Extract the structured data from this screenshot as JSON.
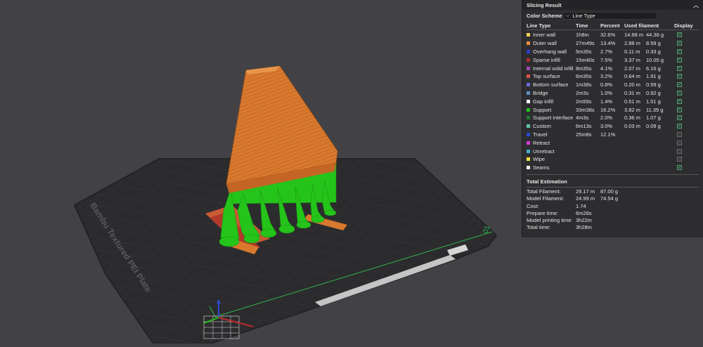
{
  "panel": {
    "title": "Slicing Result",
    "collapse_icon": "chevron-up-icon",
    "color_scheme_label": "Color Scheme",
    "color_scheme_value": "Line Type",
    "columns": [
      "Line Type",
      "Time",
      "Percent",
      "Used filament",
      "Display"
    ],
    "line_types": [
      {
        "name": "Inner wall",
        "color": "#f2d35a",
        "time": "1h8m",
        "percent": "32.6%",
        "meters": "14.88 m",
        "grams": "44.38 g",
        "display": true
      },
      {
        "name": "Outer wall",
        "color": "#f08e3c",
        "time": "27m49s",
        "percent": "13.4%",
        "meters": "2.88 m",
        "grams": "8.59 g",
        "display": true
      },
      {
        "name": "Overhang wall",
        "color": "#2a3cd0",
        "time": "5m35s",
        "percent": "2.7%",
        "meters": "0.11 m",
        "grams": "0.33 g",
        "display": true
      },
      {
        "name": "Sparse infill",
        "color": "#b02c2c",
        "time": "15m40s",
        "percent": "7.5%",
        "meters": "3.37 m",
        "grams": "10.05 g",
        "display": true
      },
      {
        "name": "Internal solid infill",
        "color": "#a14ab6",
        "time": "8m35s",
        "percent": "4.1%",
        "meters": "2.07 m",
        "grams": "6.16 g",
        "display": true
      },
      {
        "name": "Top surface",
        "color": "#e0504a",
        "time": "6m35s",
        "percent": "3.2%",
        "meters": "0.64 m",
        "grams": "1.91 g",
        "display": true
      },
      {
        "name": "Bottom surface",
        "color": "#6a6ad8",
        "time": "1m38s",
        "percent": "0.8%",
        "meters": "0.20 m",
        "grams": "0.59 g",
        "display": true
      },
      {
        "name": "Bridge",
        "color": "#5a8fc9",
        "time": "2m3s",
        "percent": "1.0%",
        "meters": "0.31 m",
        "grams": "0.92 g",
        "display": true
      },
      {
        "name": "Gap infill",
        "color": "#ffffff",
        "time": "2m59s",
        "percent": "1.4%",
        "meters": "0.51 m",
        "grams": "1.51 g",
        "display": true
      },
      {
        "name": "Support",
        "color": "#22c01a",
        "time": "33m38s",
        "percent": "16.2%",
        "meters": "3.82 m",
        "grams": "11.39 g",
        "display": true
      },
      {
        "name": "Support interface",
        "color": "#1d7a2a",
        "time": "4m3s",
        "percent": "2.0%",
        "meters": "0.36 m",
        "grams": "1.07 g",
        "display": true
      },
      {
        "name": "Custom",
        "color": "#5ac8a0",
        "time": "6m13s",
        "percent": "3.0%",
        "meters": "0.03 m",
        "grams": "0.09 g",
        "display": true
      },
      {
        "name": "Travel",
        "color": "#2a4ad0",
        "time": "25m8s",
        "percent": "12.1%",
        "meters": "",
        "grams": "",
        "display": false
      },
      {
        "name": "Retract",
        "color": "#d63ad6",
        "time": "",
        "percent": "",
        "meters": "",
        "grams": "",
        "display": false
      },
      {
        "name": "Unretract",
        "color": "#40b0c8",
        "time": "",
        "percent": "",
        "meters": "",
        "grams": "",
        "display": false
      },
      {
        "name": "Wipe",
        "color": "#f2e23a",
        "time": "",
        "percent": "",
        "meters": "",
        "grams": "",
        "display": false
      },
      {
        "name": "Seams",
        "color": "#f0f0f0",
        "time": "",
        "percent": "",
        "meters": "",
        "grams": "",
        "display": true
      }
    ],
    "total_title": "Total Estimation",
    "totals": [
      {
        "label": "Total Filament:",
        "v1": "29.17 m",
        "v2": "87.00 g"
      },
      {
        "label": "Model Filament:",
        "v1": "24.99 m",
        "v2": "74.54 g"
      },
      {
        "label": "Cost:",
        "v1": "1.74",
        "v2": ""
      },
      {
        "label": "Prepare time:",
        "v1": "6m26s",
        "v2": ""
      },
      {
        "label": "Model printing time:",
        "v1": "3h22m",
        "v2": ""
      },
      {
        "label": "Total time:",
        "v1": "3h28m",
        "v2": ""
      }
    ]
  },
  "viewport": {
    "plate_name": "Bambu Textured PEI Plate",
    "plate_number": "01",
    "colors": {
      "background": "#424246",
      "plate": "#2b2b2d",
      "model": "#d9792e",
      "support": "#25c41b",
      "raft": "#c85a34"
    }
  }
}
